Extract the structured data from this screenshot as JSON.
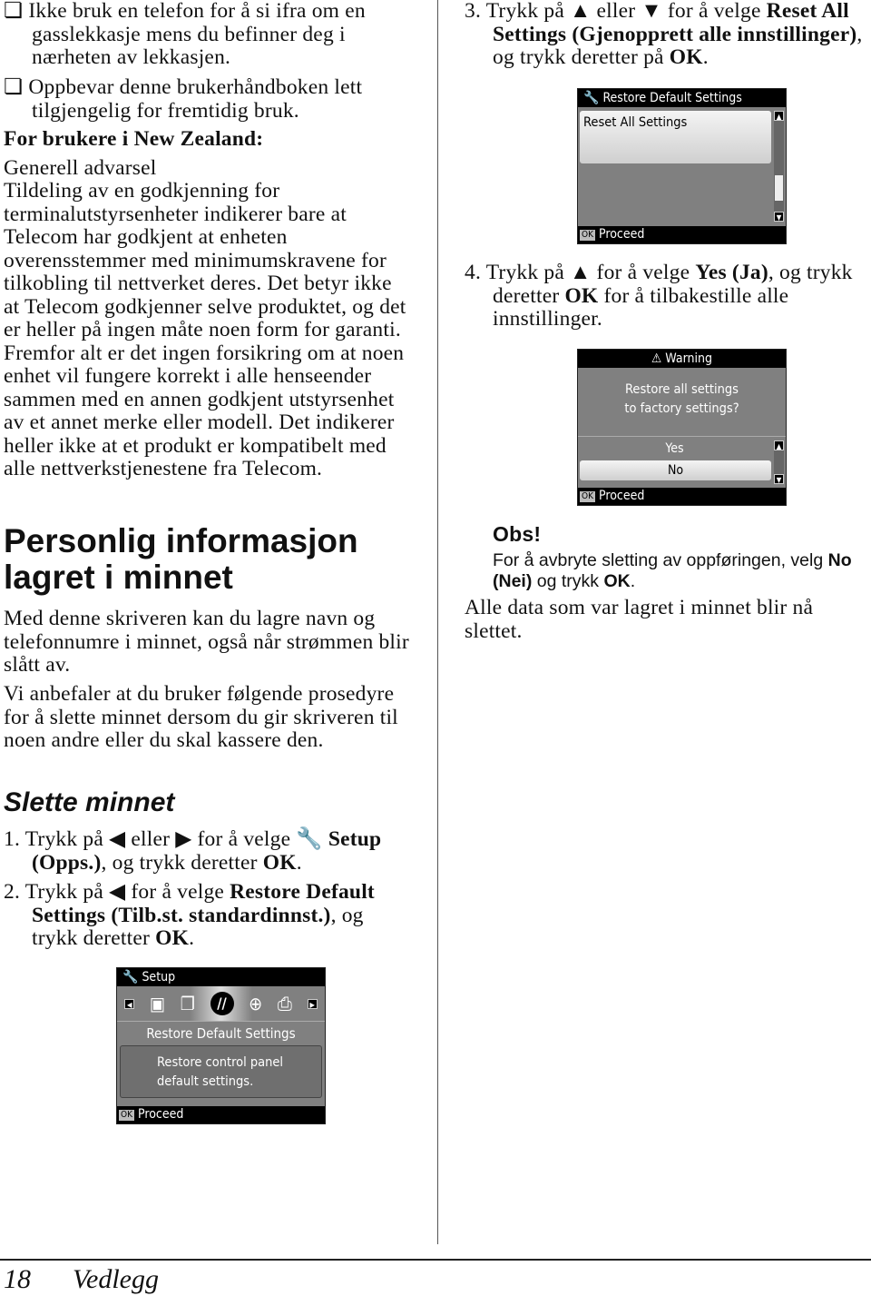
{
  "left": {
    "bullets": [
      [
        {
          "t": "❏ "
        },
        {
          "t": "Ikke bruk en telefon for å si ifra om en gasslekkasje mens du befinner deg i nærheten av lekkasjen."
        }
      ],
      [
        {
          "t": "❏ "
        },
        {
          "t": "Oppbevar denne brukerhåndboken lett tilgjengelig for fremtidig bruk."
        }
      ]
    ],
    "nz_heading": "For brukere i New Zealand:",
    "nz_sub": "Generell advarsel",
    "nz_para": "Tildeling av en godkjenning for terminalutstyrsenheter indikerer bare at Telecom har godkjent at enheten overensstemmer med minimumskravene for tilkobling til nettverket deres. Det betyr ikke at Telecom godkjenner selve produktet, og det er heller på ingen måte noen form for garanti. Fremfor alt er det ingen forsikring om at noen enhet vil fungere korrekt i alle henseender sammen med en annen godkjent utstyrsenhet av et annet merke eller modell. Det indikerer heller ikke at et produkt er kompatibelt med alle nettverkstjenestene fra Telecom.",
    "h1": "Personlig informasjon lagret i minnet",
    "p1": "Med denne skriveren kan du lagre navn og telefonnumre i minnet, også når strømmen blir slått av.",
    "p2": "Vi anbefaler at du bruker følgende prosedyre for å slette minnet dersom du gir skriveren til noen andre eller du skal kassere den.",
    "h2": "Slette minnet",
    "steps": [
      [
        {
          "t": "1. "
        },
        {
          "t": "Trykk på ◀ eller ▶ for å velge "
        },
        {
          "t": "🔧 Setup (Opps.)",
          "b": true
        },
        {
          "t": ", og trykk deretter "
        },
        {
          "t": "OK",
          "b": true
        },
        {
          "t": "."
        }
      ],
      [
        {
          "t": "2. "
        },
        {
          "t": "Trykk på ◀ for å velge "
        },
        {
          "t": "Restore Default Settings (Tilb.st. standardinnst.)",
          "b": true
        },
        {
          "t": ", og trykk deretter "
        },
        {
          "t": "OK",
          "b": true
        },
        {
          "t": "."
        }
      ]
    ]
  },
  "right": {
    "steps": [
      [
        {
          "t": "3. "
        },
        {
          "t": "Trykk på ▲ eller ▼ for å velge "
        },
        {
          "t": "Reset All Settings (Gjenopprett alle innstillinger)",
          "b": true
        },
        {
          "t": ", og trykk deretter på "
        },
        {
          "t": "OK",
          "b": true
        },
        {
          "t": "."
        }
      ],
      [
        {
          "t": "4. "
        },
        {
          "t": "Trykk på ▲ for å velge "
        },
        {
          "t": "Yes (Ja)",
          "b": true
        },
        {
          "t": ", og trykk deretter "
        },
        {
          "t": "OK",
          "b": true
        },
        {
          "t": " for å tilbakestille alle innstillinger."
        }
      ]
    ],
    "note_title": "Obs!",
    "note": [
      {
        "t": "For å avbryte sletting av oppføringen, velg "
      },
      {
        "t": "No (Nei)",
        "b": true
      },
      {
        "t": " og trykk "
      },
      {
        "t": "OK",
        "b": true
      },
      {
        "t": "."
      }
    ],
    "final": "Alle data som var lagret i minnet blir nå slettet."
  },
  "screens": {
    "setup": {
      "title": "Setup",
      "icon": "setup-wrench-icon",
      "selected": "Restore Default Settings",
      "desc1": "Restore control panel",
      "desc2": "default settings.",
      "ok": "OK",
      "proceed": "Proceed"
    },
    "restore": {
      "title": "Restore Default Settings",
      "icon": "setup-wrench-icon",
      "item": "Reset All Settings",
      "ok": "OK",
      "proceed": "Proceed"
    },
    "warning": {
      "title": "Warning",
      "icon": "warning-icon",
      "msg1": "Restore all settings",
      "msg2": "to factory settings?",
      "opt_yes": "Yes",
      "opt_no": "No",
      "selected": "No",
      "ok": "OK",
      "proceed": "Proceed"
    }
  },
  "footer": {
    "page": "18",
    "section": "Vedlegg"
  }
}
